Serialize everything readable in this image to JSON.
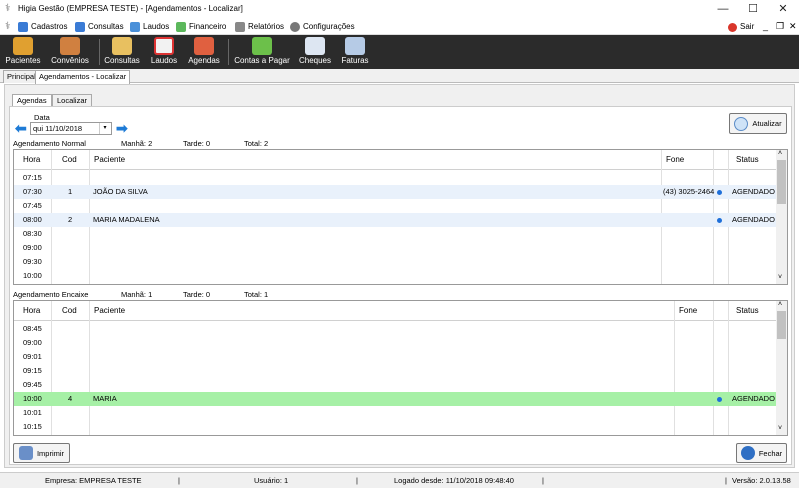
{
  "window": {
    "title": "Higia Gestão (EMPRESA TESTE) - [Agendamentos - Localizar]"
  },
  "menu": {
    "items": [
      {
        "label": "Cadastros",
        "icon": "folder-icon",
        "color": "#3a7bd5"
      },
      {
        "label": "Consultas",
        "icon": "consultas-icon",
        "color": "#3a7bd5"
      },
      {
        "label": "Laudos",
        "icon": "laudos-icon",
        "color": "#4a90d9"
      },
      {
        "label": "Financeiro",
        "icon": "money-icon",
        "color": "#5cb85c"
      },
      {
        "label": "Relatórios",
        "icon": "report-icon",
        "color": "#888888"
      },
      {
        "label": "Configurações",
        "icon": "gear-icon",
        "color": "#777777"
      }
    ],
    "sair": "Sair"
  },
  "toolbar": {
    "items": [
      {
        "label": "Pacientes",
        "icon": "patients-icon",
        "color": "#e0a030"
      },
      {
        "label": "Convênios",
        "icon": "agreements-icon",
        "color": "#d08040"
      },
      {
        "label": "Consultas",
        "icon": "consultas-icon",
        "color": "#e8c060"
      },
      {
        "label": "Laudos",
        "icon": "laudos-icon",
        "color": "#f2f2f2"
      },
      {
        "label": "Agendas",
        "icon": "calendar-icon",
        "color": "#e06040"
      },
      {
        "label": "Contas a Pagar",
        "icon": "money-icon",
        "color": "#6cc04a"
      },
      {
        "label": "Cheques",
        "icon": "cheque-icon",
        "color": "#dde6f2"
      },
      {
        "label": "Faturas",
        "icon": "invoice-icon",
        "color": "#b6cbe6"
      }
    ]
  },
  "main_tabs": [
    "Principal",
    "Agendamentos - Localizar"
  ],
  "inner_tabs": [
    "Agendas",
    "Localizar"
  ],
  "filter": {
    "date_label": "Data",
    "date_value": "qui  11/10/2018",
    "refresh_label": "Atualizar"
  },
  "normal": {
    "title": "Agendamento Normal",
    "morning": "Manhã: 2",
    "afternoon": "Tarde: 0",
    "total": "Total: 2",
    "headers": [
      "Hora",
      "Cod",
      "Paciente",
      "Fone",
      "Status"
    ],
    "rows": [
      {
        "hora": "07:15",
        "cod": "",
        "paciente": "",
        "fone": "",
        "status": ""
      },
      {
        "hora": "07:30",
        "cod": "1",
        "paciente": "JOÃO DA SILVA",
        "fone": "(43) 3025-2464",
        "status": "AGENDADO"
      },
      {
        "hora": "07:45",
        "cod": "",
        "paciente": "",
        "fone": "",
        "status": ""
      },
      {
        "hora": "08:00",
        "cod": "2",
        "paciente": "MARIA MADALENA",
        "fone": "",
        "status": "AGENDADO"
      },
      {
        "hora": "08:30",
        "cod": "",
        "paciente": "",
        "fone": "",
        "status": ""
      },
      {
        "hora": "09:00",
        "cod": "",
        "paciente": "",
        "fone": "",
        "status": ""
      },
      {
        "hora": "09:30",
        "cod": "",
        "paciente": "",
        "fone": "",
        "status": ""
      },
      {
        "hora": "10:00",
        "cod": "",
        "paciente": "",
        "fone": "",
        "status": ""
      }
    ]
  },
  "encaixe": {
    "title": "Agendamento Encaixe",
    "morning": "Manhã: 1",
    "afternoon": "Tarde: 0",
    "total": "Total: 1",
    "headers": [
      "Hora",
      "Cod",
      "Paciente",
      "Fone",
      "Status"
    ],
    "rows": [
      {
        "hora": "08:45",
        "cod": "",
        "paciente": "",
        "fone": "",
        "status": ""
      },
      {
        "hora": "09:00",
        "cod": "",
        "paciente": "",
        "fone": "",
        "status": ""
      },
      {
        "hora": "09:01",
        "cod": "",
        "paciente": "",
        "fone": "",
        "status": ""
      },
      {
        "hora": "09:15",
        "cod": "",
        "paciente": "",
        "fone": "",
        "status": ""
      },
      {
        "hora": "09:45",
        "cod": "",
        "paciente": "",
        "fone": "",
        "status": ""
      },
      {
        "hora": "10:00",
        "cod": "4",
        "paciente": "MARIA",
        "fone": "",
        "status": "AGENDADO"
      },
      {
        "hora": "10:01",
        "cod": "",
        "paciente": "",
        "fone": "",
        "status": ""
      },
      {
        "hora": "10:15",
        "cod": "",
        "paciente": "",
        "fone": "",
        "status": ""
      }
    ]
  },
  "buttons": {
    "print": "Imprimir",
    "close": "Fechar"
  },
  "statusbar": {
    "empresa": "Empresa: EMPRESA TESTE",
    "usuario": "Usuário: 1",
    "logado": "Logado desde: 11/10/2018 09:48:40",
    "versao": "Versão: 2.0.13.58"
  },
  "colors": {
    "toolbar_bg": "#2b2b2b",
    "selected_row": "#a6f0a6",
    "alt_row": "#e9f1fb",
    "status_dot": "#1e6fd9",
    "accent": "#1e7bd6"
  }
}
